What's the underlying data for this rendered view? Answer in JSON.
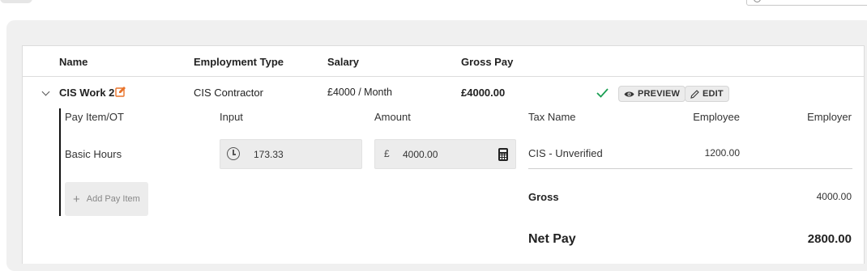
{
  "table": {
    "headers": {
      "name": "Name",
      "employment_type": "Employment Type",
      "salary": "Salary",
      "gross_pay": "Gross Pay"
    },
    "row": {
      "name": "CIS Work 2",
      "employment_type": "CIS Contractor",
      "salary": "£4000 / Month",
      "gross_pay": "£4000.00",
      "preview_label": "PREVIEW",
      "edit_label": "EDIT",
      "status": "saved"
    }
  },
  "pay_items": {
    "headers": {
      "item": "Pay Item/OT",
      "input": "Input",
      "amount": "Amount"
    },
    "items": [
      {
        "name": "Basic Hours",
        "input": "173.33",
        "currency": "£",
        "amount": "4000.00"
      }
    ],
    "add_label": "Add Pay Item"
  },
  "tax": {
    "headers": {
      "tax_name": "Tax Name",
      "employee": "Employee",
      "employer": "Employer"
    },
    "rows": [
      {
        "name": "CIS - Unverified",
        "employee": "1200.00",
        "employer": ""
      }
    ],
    "gross_label": "Gross",
    "gross_value": "4000.00",
    "net_label": "Net Pay",
    "net_value": "2800.00"
  },
  "colors": {
    "accent_check": "#1a9e52",
    "pencil": "#e8732a",
    "panel_bg": "#f0f0f0"
  },
  "icons": [
    "search-icon",
    "chevron-down-icon",
    "pencil-icon",
    "check-icon",
    "eye-icon",
    "edit-icon",
    "clock-icon",
    "calculator-icon",
    "plus-icon"
  ]
}
